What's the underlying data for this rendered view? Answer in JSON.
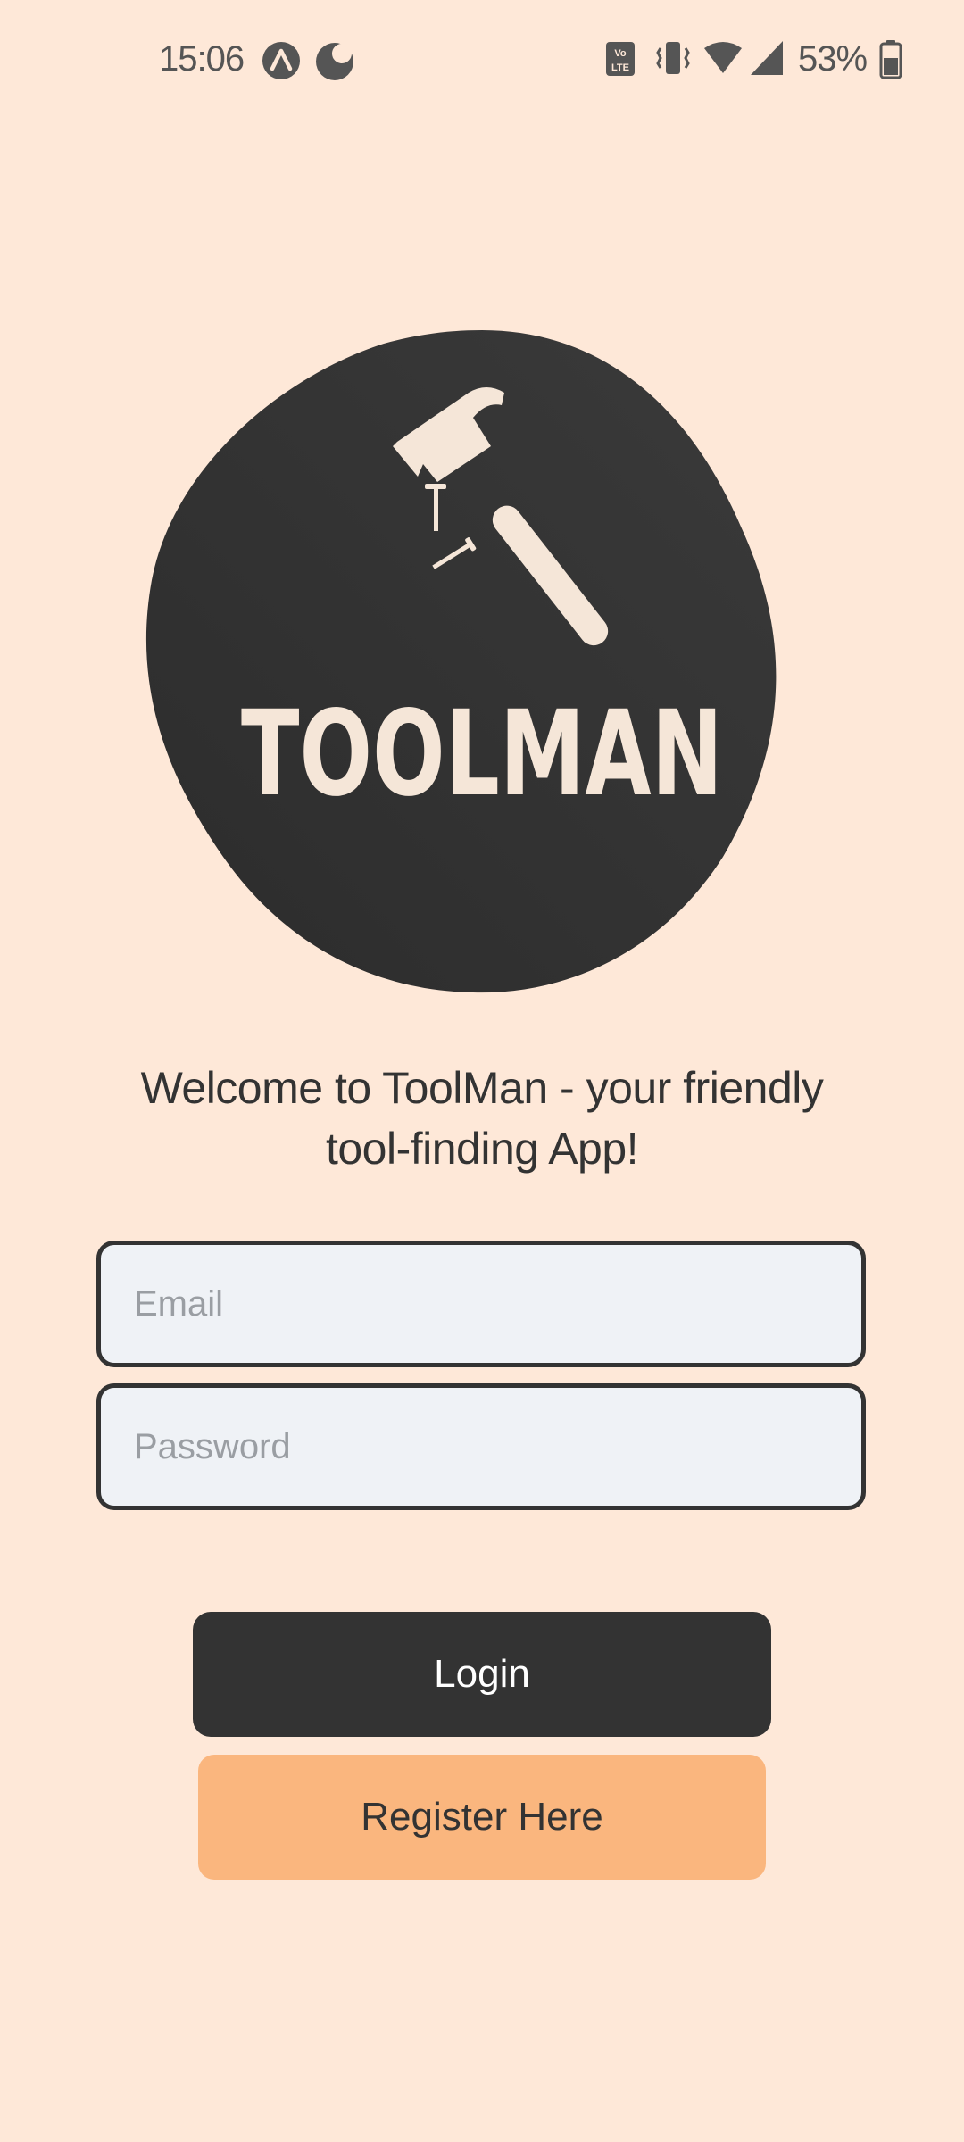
{
  "status_bar": {
    "time": "15:06",
    "battery_percent": "53%",
    "left_icons": [
      "app-notification-icon",
      "do-not-disturb-moon-icon"
    ],
    "right_icons": [
      "volte-icon",
      "vibrate-icon",
      "wifi-icon",
      "cellular-signal-icon",
      "battery-icon"
    ]
  },
  "logo": {
    "wordmark": "TOOLMAN",
    "icon": "hammer-and-nails-icon",
    "blob_color": "#333333",
    "ink_color": "#f5e6d8"
  },
  "welcome": {
    "line1": "Welcome to ToolMan - your friendly",
    "line2": "tool-finding App!"
  },
  "form": {
    "email_placeholder": "Email",
    "email_value": "",
    "password_placeholder": "Password",
    "password_value": ""
  },
  "buttons": {
    "login_label": "Login",
    "register_label": "Register Here"
  },
  "colors": {
    "background": "#fee8d8",
    "primary_dark": "#333333",
    "accent_orange": "#fab67e",
    "input_fill": "#eff2f6"
  }
}
